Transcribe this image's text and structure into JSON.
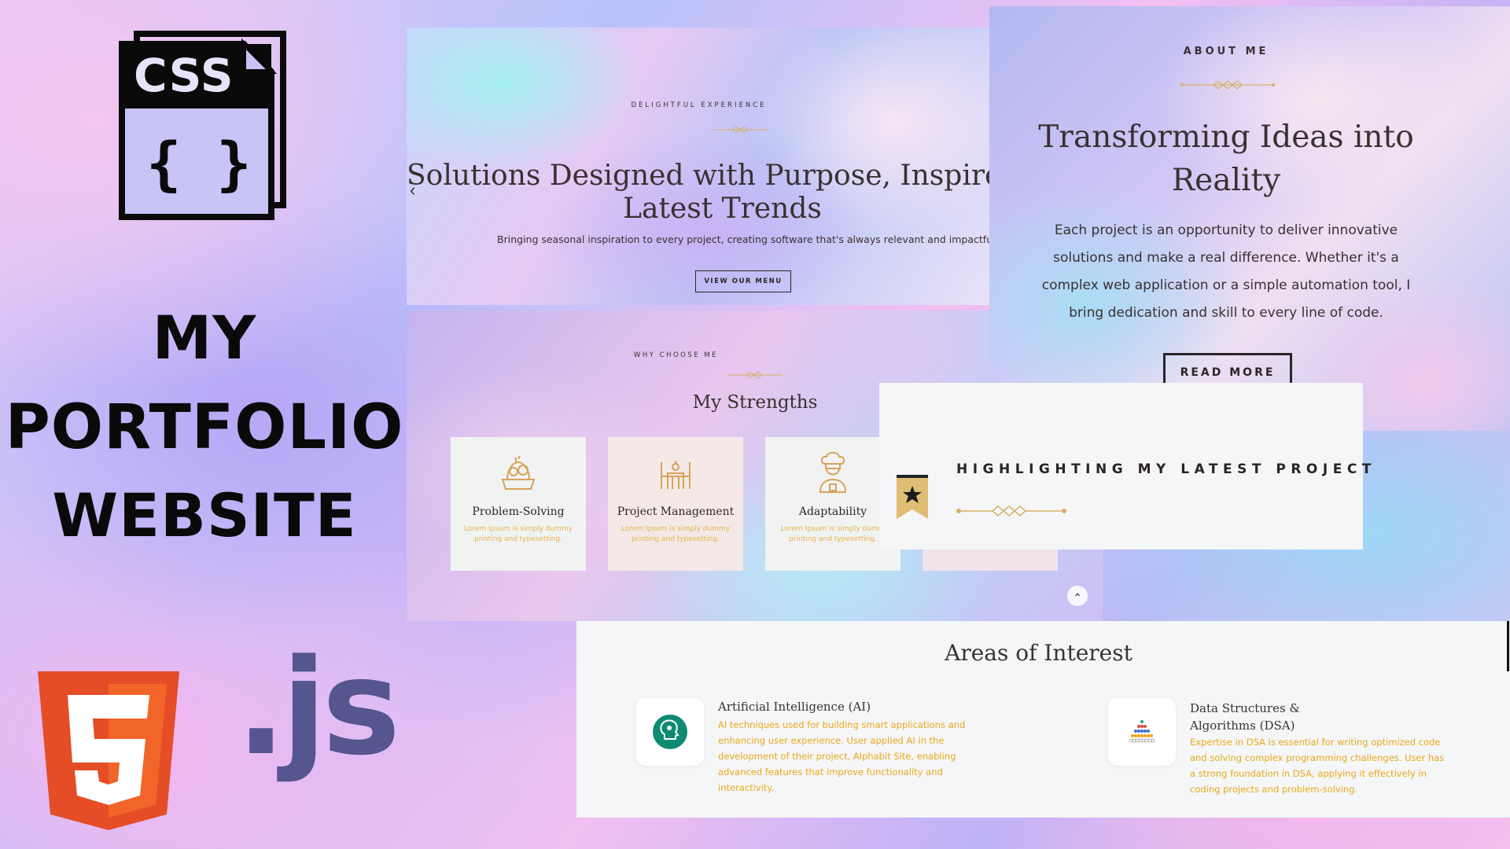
{
  "left": {
    "css_badge": "CSS",
    "css_braces": "{ }",
    "title_lines": [
      "MY",
      "PORTFOLIO",
      "WEBSITE"
    ],
    "html5_badge": "5",
    "js_label": ".js",
    "colors": {
      "html5": "#e44d26",
      "html5_light": "#f16529",
      "js": "#55558f"
    }
  },
  "hero": {
    "eyebrow": "DELIGHTFUL EXPERIENCE",
    "heading_line1": "Solutions Designed with Purpose, Inspired",
    "heading_line2": "Latest Trends",
    "subtitle": "Bringing seasonal inspiration to every project, creating software that's always relevant and impactful",
    "button": "VIEW OUR MENU",
    "prev_arrow": "‹"
  },
  "about": {
    "eyebrow": "ABOUT ME",
    "heading_line1": "Transforming Ideas into",
    "heading_line2": "Reality",
    "paragraph_lines": [
      "Each project is an opportunity to deliver innovative",
      "solutions and make a real difference. Whether it's a",
      "complex web application or a simple automation tool, I",
      "bring dedication and skill to every line of code."
    ],
    "button": "READ MORE"
  },
  "strengths": {
    "eyebrow": "WHY CHOOSE ME",
    "heading": "My Strengths",
    "cards": [
      {
        "title": "Problem-Solving",
        "text_line1": "Lorem Ipsum is simply dummy",
        "text_line2": "printing and typesetting.",
        "icon": "basket-icon"
      },
      {
        "title": "Project Management",
        "text_line1": "Lorem Ipsum is simply dummy",
        "text_line2": "printing and typesetting.",
        "icon": "table-icon"
      },
      {
        "title": "Adaptability",
        "text_line1": "Lorem Ipsum is simply dumm",
        "text_line2": "printing and typesetting.",
        "icon": "chef-icon"
      }
    ],
    "scroll_up": "⌃"
  },
  "latest_project": {
    "heading": "HIGHLIGHTING MY LATEST PROJECT",
    "badge_icon": "star-bookmark-icon"
  },
  "interests": {
    "heading": "Areas of Interest",
    "items": [
      {
        "title": "Artificial Intelligence (AI)",
        "desc_lines": [
          "AI techniques used for building smart applications and",
          "enhancing user experience. User applied AI in the",
          "development of their project, Alphabit Site, enabling",
          "advanced features that improve functionality and",
          "interactivity."
        ],
        "icon": "ai-brain-icon"
      },
      {
        "title_line1": "Data Structures &",
        "title_line2": "Algorithms (DSA)",
        "desc_lines": [
          "Expertise in DSA is essential for writing optimized code",
          "and solving complex programming challenges. User has",
          "a strong foundation in DSA, applying it effectively in",
          "coding projects and problem-solving."
        ],
        "icon": "pyramid-dots-icon"
      }
    ]
  },
  "accent": {
    "gold": "#e8b24a",
    "ornament": "#d9b06a",
    "dark": "#2b2424"
  }
}
